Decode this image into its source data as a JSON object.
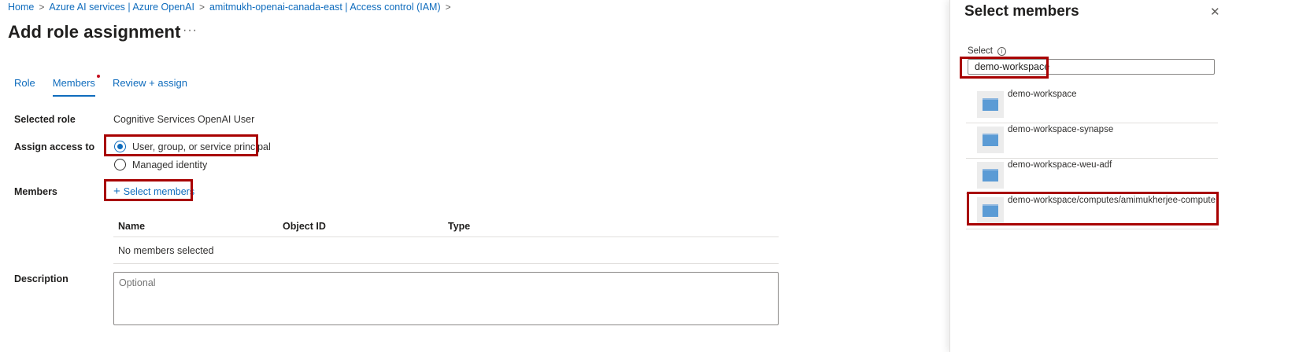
{
  "breadcrumb": [
    {
      "label": "Home"
    },
    {
      "label": "Azure AI services | Azure OpenAI"
    },
    {
      "label": "amitmukh-openai-canada-east | Access control (IAM)"
    }
  ],
  "breadcrumb_separator": ">",
  "page_title": "Add role assignment",
  "more_label": "···",
  "tabs": [
    {
      "label": "Role",
      "active": false
    },
    {
      "label": "Members",
      "active": true
    },
    {
      "label": "Review + assign",
      "active": false
    }
  ],
  "form": {
    "selected_role_label": "Selected role",
    "selected_role_value": "Cognitive Services OpenAI User",
    "assign_access_label": "Assign access to",
    "assign_options": [
      {
        "label": "User, group, or service principal",
        "checked": true
      },
      {
        "label": "Managed identity",
        "checked": false
      }
    ],
    "members_label": "Members",
    "select_members_link": "Select members",
    "table_headers": [
      "Name",
      "Object ID",
      "Type"
    ],
    "no_members_text": "No members selected",
    "description_label": "Description",
    "description_placeholder": "Optional"
  },
  "panel": {
    "title": "Select members",
    "close_icon": "close-icon",
    "select_label": "Select",
    "info_symbol": "i",
    "search_value": "demo-workspace",
    "results": [
      {
        "name": "demo-workspace"
      },
      {
        "name": "demo-workspace-synapse"
      },
      {
        "name": "demo-workspace-weu-adf"
      },
      {
        "name": "demo-workspace/computes/amimukherjee-compute"
      }
    ]
  },
  "colors": {
    "accent": "#0f6cbd",
    "highlight": "#a80000",
    "tab_dot": "#c50f1f"
  }
}
